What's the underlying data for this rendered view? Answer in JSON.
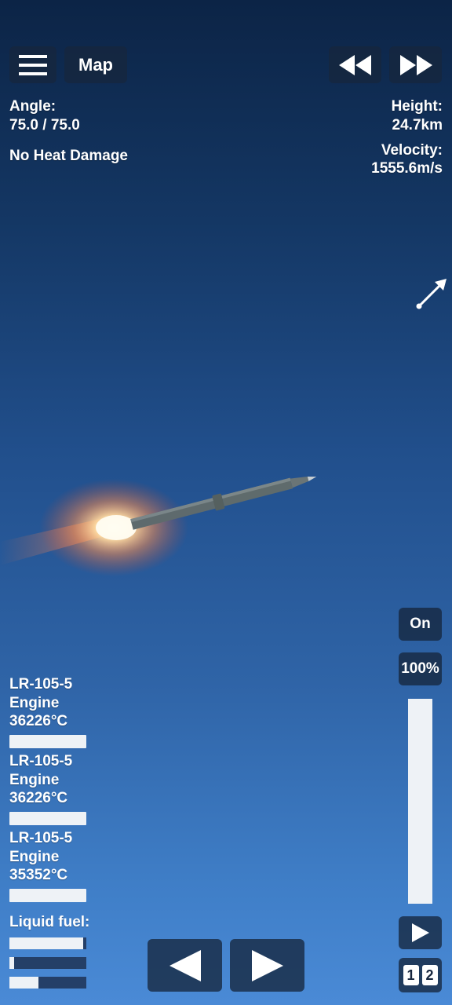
{
  "top_bar": {
    "menu_icon": "hamburger-menu-icon",
    "map_label": "Map",
    "rewind_icon": "rewind-icon",
    "fast_forward_icon": "fast-forward-icon"
  },
  "flight_info": {
    "angle_label": "Angle:",
    "angle_value": "75.0 / 75.0",
    "heat_status": "No Heat Damage",
    "height_label": "Height:",
    "height_value": "24.7km",
    "velocity_label": "Velocity:",
    "velocity_value": "1555.6m/s"
  },
  "direction_arrow_icon": "arrow-up-right-icon",
  "engines": [
    {
      "name_line1": "LR-105-5",
      "name_line2": "Engine",
      "temperature": "36226°C"
    },
    {
      "name_line1": "LR-105-5",
      "name_line2": "Engine",
      "temperature": "36226°C"
    },
    {
      "name_line1": "LR-105-5",
      "name_line2": "Engine",
      "temperature": "35352°C"
    }
  ],
  "fuel": {
    "label": "Liquid fuel:",
    "levels": [
      0.96,
      0.06,
      0.38
    ]
  },
  "throttle": {
    "engine_toggle": "On",
    "percent_label": "100%",
    "level": 1.0
  },
  "controls": {
    "rotate_left_icon": "triangle-left-icon",
    "rotate_right_icon": "triangle-right-icon",
    "play_icon": "play-icon",
    "stage_one": "1",
    "stage_two": "2"
  },
  "colors": {
    "sky_top": "#0c2446",
    "sky_bottom": "#4a8ad6",
    "button_bg": "#16263e",
    "bar_fill": "#eef2f6"
  }
}
